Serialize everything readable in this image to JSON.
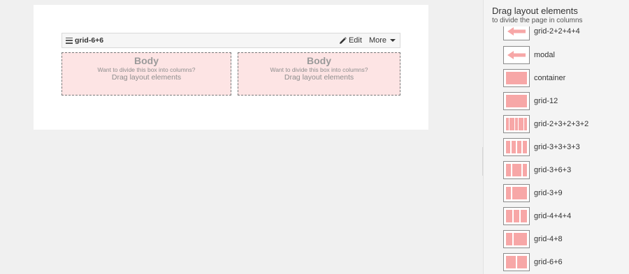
{
  "canvas": {
    "grid": {
      "title": "grid-6+6",
      "edit_label": "Edit",
      "more_label": "More",
      "columns": [
        {
          "title": "Body",
          "hint": "Want to divide this box into columns?",
          "cta": "Drag layout elements"
        },
        {
          "title": "Body",
          "hint": "Want to divide this box into columns?",
          "cta": "Drag layout elements"
        }
      ]
    }
  },
  "sidebar": {
    "title": "Drag layout elements",
    "subtitle": "to divide the page in columns",
    "items": [
      {
        "label": "grid-2+2+4+4",
        "icon": "arrow-left-icon"
      },
      {
        "label": "modal",
        "icon": "arrow-left-icon"
      },
      {
        "label": "container",
        "icon": "container-icon"
      },
      {
        "label": "grid-12",
        "icon": "grid-12-icon"
      },
      {
        "label": "grid-2+3+2+3+2",
        "icon": "grid-2-3-2-3-2-icon"
      },
      {
        "label": "grid-3+3+3+3",
        "icon": "grid-3-3-3-3-icon"
      },
      {
        "label": "grid-3+6+3",
        "icon": "grid-3-6-3-icon"
      },
      {
        "label": "grid-3+9",
        "icon": "grid-3-9-icon"
      },
      {
        "label": "grid-4+4+4",
        "icon": "grid-4-4-4-icon"
      },
      {
        "label": "grid-4+8",
        "icon": "grid-4-8-icon"
      },
      {
        "label": "grid-6+6",
        "icon": "grid-6-6-icon"
      }
    ]
  },
  "colors": {
    "accent_pink": "#f7a7a7",
    "drop_zone_bg": "#fde4e4"
  }
}
